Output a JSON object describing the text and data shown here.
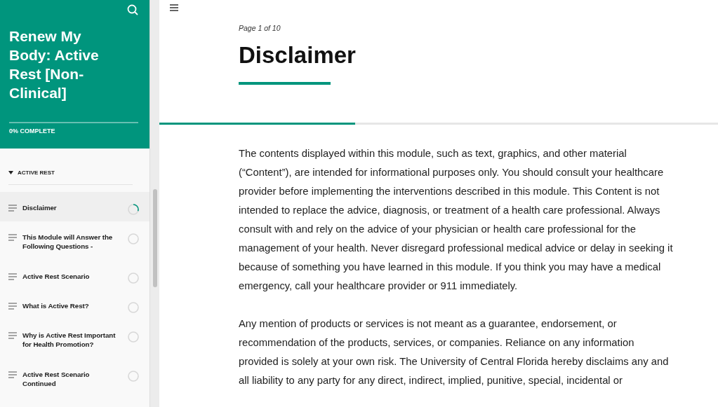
{
  "course": {
    "title": "Renew My Body: Active Rest [Non-Clinical]",
    "progress_label": "0% COMPLETE"
  },
  "section": {
    "title": "ACTIVE REST",
    "expanded": true
  },
  "lessons": [
    {
      "title": "Disclaimer",
      "selected": true,
      "kind": "in_progress"
    },
    {
      "title": "This Module will Answer the Following Questions -",
      "selected": false,
      "kind": "not_started"
    },
    {
      "title": "Active Rest Scenario",
      "selected": false,
      "kind": "not_started"
    },
    {
      "title": "What is Active Rest?",
      "selected": false,
      "kind": "not_started"
    },
    {
      "title": "Why is Active Rest Important for Health Promotion?",
      "selected": false,
      "kind": "not_started"
    },
    {
      "title": "Active Rest Scenario Continued",
      "selected": false,
      "kind": "not_started"
    }
  ],
  "page": {
    "counter": "Page 1 of 10",
    "title": "Disclaimer",
    "level": 0.35,
    "paragraphs": [
      "The contents displayed within this module, such as text, graphics, and other material (“Content”), are intended for informational purposes only. You should consult your healthcare provider before implementing the interventions described in this module. This Content is not intended to replace the advice, diagnosis, or treatment of a health care professional. Always consult with and rely on the advice of your physician or health care professional for the management of your health. Never disregard professional medical advice or delay in seeking it because of something you have learned in this module. If you think you may have a medical emergency, call your healthcare provider or 911 immediately.",
      "Any mention of products or services is not meant as a guarantee, endorsement, or recommendation of the products, services, or companies. Reliance on any information provided is solely at your own risk. The University of Central Florida hereby disclaims any and all liability to any party for any direct, indirect, implied, punitive, special, incidental or"
    ]
  }
}
